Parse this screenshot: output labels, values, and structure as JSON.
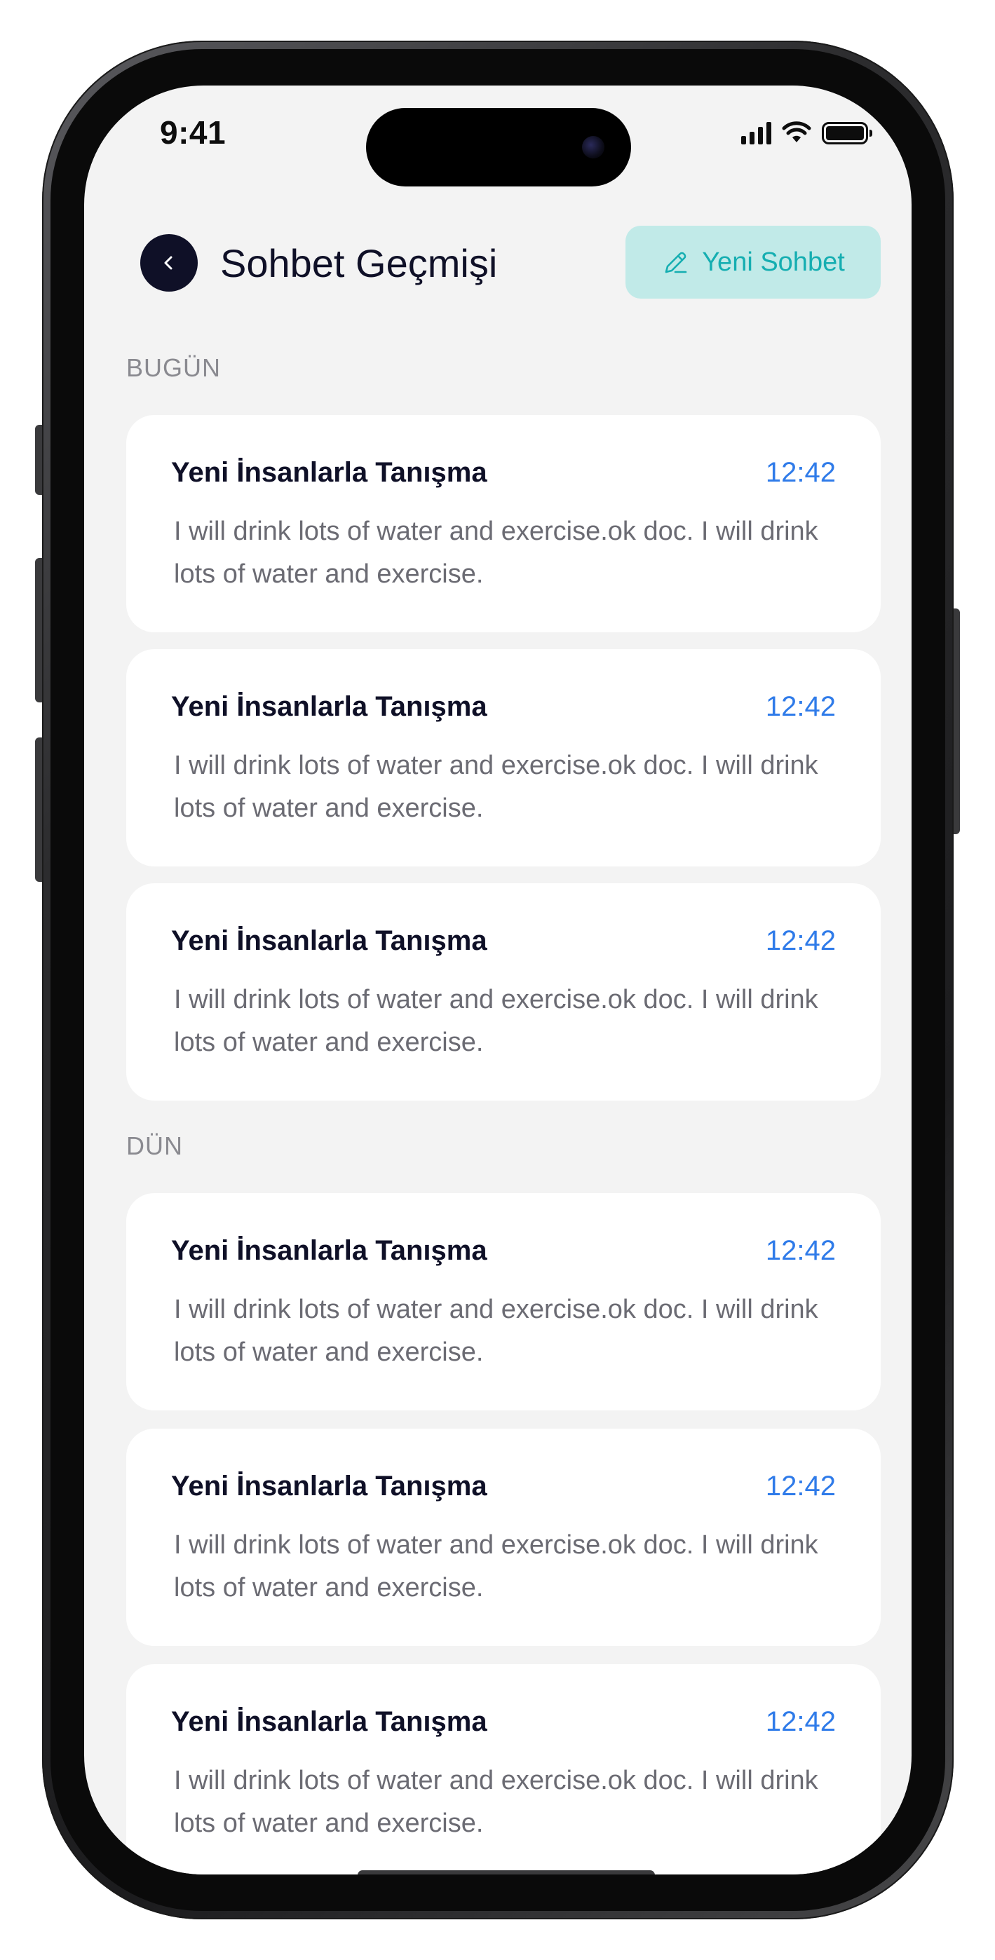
{
  "status_bar": {
    "time": "9:41",
    "icons": [
      "cellular-signal-icon",
      "wifi-icon",
      "battery-icon"
    ]
  },
  "header": {
    "back_icon": "chevron-left-icon",
    "title": "Sohbet Geçmişi",
    "new_chat": {
      "icon": "pencil-icon",
      "label": "Yeni Sohbet"
    }
  },
  "sections": [
    {
      "label": "BUGÜN",
      "items": [
        {
          "title": "Yeni İnsanlarla Tanışma",
          "time": "12:42",
          "preview": "I will drink lots of water and exercise.ok doc. I will drink lots of water and exercise."
        },
        {
          "title": "Yeni İnsanlarla Tanışma",
          "time": "12:42",
          "preview": "I will drink lots of water and exercise.ok doc. I will drink lots of water and exercise."
        },
        {
          "title": "Yeni İnsanlarla Tanışma",
          "time": "12:42",
          "preview": "I will drink lots of water and exercise.ok doc. I will drink lots of water and exercise."
        }
      ]
    },
    {
      "label": "DÜN",
      "items": [
        {
          "title": "Yeni İnsanlarla Tanışma",
          "time": "12:42",
          "preview": "I will drink lots of water and exercise.ok doc. I will drink lots of water and exercise."
        },
        {
          "title": "Yeni İnsanlarla Tanışma",
          "time": "12:42",
          "preview": "I will drink lots of water and exercise.ok doc. I will drink lots of water and exercise."
        },
        {
          "title": "Yeni İnsanlarla Tanışma",
          "time": "12:42",
          "preview": "I will drink lots of water and exercise.ok doc. I will drink lots of water and exercise."
        }
      ]
    }
  ],
  "colors": {
    "background": "#f3f3f3",
    "card": "#ffffff",
    "title_text": "#0f1027",
    "body_text": "#6b6b73",
    "time_text": "#2f7be9",
    "accent_button_bg": "#c1eae8",
    "accent_button_text": "#15aeb1"
  }
}
